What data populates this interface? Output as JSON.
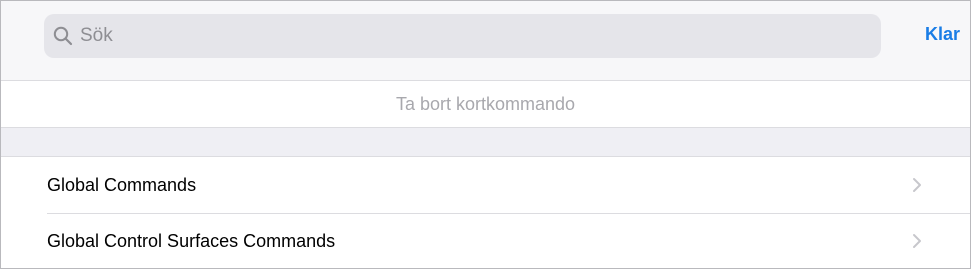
{
  "search": {
    "placeholder": "Sök",
    "value": ""
  },
  "header": {
    "done_label": "Klar"
  },
  "remove_shortcut": {
    "label": "Ta bort kortkommando"
  },
  "commands": {
    "items": [
      {
        "label": "Global Commands",
        "icon": "chevron-right-icon"
      },
      {
        "label": "Global Control Surfaces Commands",
        "icon": "chevron-right-icon"
      }
    ]
  },
  "colors": {
    "accent": "#1a7de6",
    "search_bg": "#e5e5ea",
    "group_bg": "#efeff4",
    "disabled_text": "#a8a8ad"
  }
}
